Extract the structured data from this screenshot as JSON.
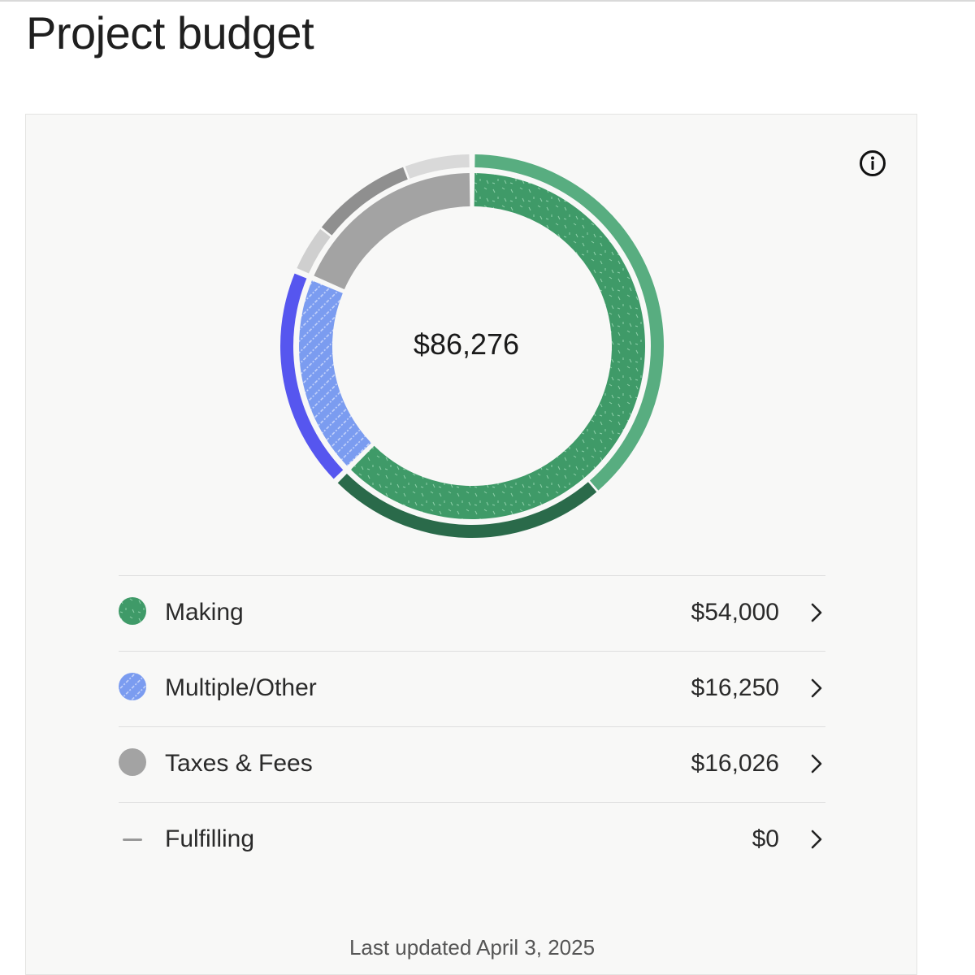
{
  "header": {
    "title": "Project budget"
  },
  "card": {
    "info_icon": "info-icon",
    "total": "$86,276",
    "last_updated": "Last updated April 3, 2025",
    "items": [
      {
        "label": "Making",
        "amount": "$54,000",
        "swatch": "dot",
        "color": "#3f9a68",
        "pattern": "speckle"
      },
      {
        "label": "Multiple/Other",
        "amount": "$16,250",
        "swatch": "dot",
        "color": "#7b9cf0",
        "pattern": "diagonal-dots"
      },
      {
        "label": "Taxes & Fees",
        "amount": "$16,026",
        "swatch": "dot",
        "color": "#a3a3a3",
        "pattern": "solid"
      },
      {
        "label": "Fulfilling",
        "amount": "$0",
        "swatch": "dash",
        "color": "#999999",
        "pattern": "none"
      }
    ]
  },
  "chart_data": {
    "type": "pie",
    "style": "double-ring donut",
    "center_label": "$86,276",
    "inner_ring": [
      {
        "label": "Making",
        "value": 54000,
        "color": "#3f9a68"
      },
      {
        "label": "Multiple/Other",
        "value": 16250,
        "color": "#7b9cf0"
      },
      {
        "label": "Taxes & Fees",
        "value": 16026,
        "color": "#a3a3a3"
      }
    ],
    "outer_ring_colors": {
      "Making": [
        "#58ad80",
        "#2a6a4a"
      ],
      "Multiple/Other": [
        "#5656ef"
      ],
      "Taxes & Fees": [
        "#cfcfcf",
        "#8f8f8f",
        "#d9d9d9"
      ]
    }
  }
}
